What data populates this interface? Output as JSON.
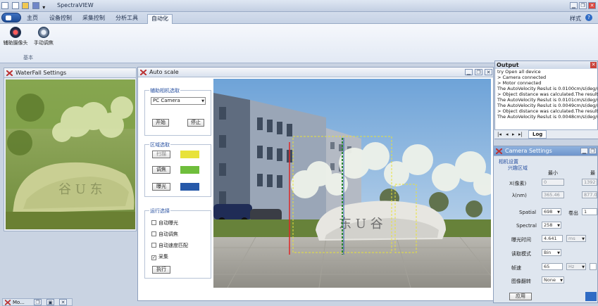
{
  "app": {
    "title": "SpectraVIEW",
    "style_label": "样式",
    "help_icon": "help-icon"
  },
  "tabs": [
    {
      "label": "主页"
    },
    {
      "label": "设备控制"
    },
    {
      "label": "采集控制"
    },
    {
      "label": "分析工具"
    },
    {
      "label": "自动化"
    }
  ],
  "ribbon": {
    "buttons": [
      {
        "label": "辅助摄像头",
        "icon": "camera-icon"
      },
      {
        "label": "手动调焦",
        "icon": "focus-icon"
      }
    ],
    "group_label": "基本"
  },
  "waterfall": {
    "title": "WaterFall Settings"
  },
  "autoscale": {
    "title": "Auto scale",
    "camera_group": {
      "title": "辅助相机选取",
      "select_value": "PC Camera",
      "start_label": "开始",
      "stop_label": "停止"
    },
    "region_group": {
      "title": "区域选取",
      "items": [
        {
          "label": "扫描",
          "color": "#e8e23a"
        },
        {
          "label": "调焦",
          "color": "#6fbe3c"
        },
        {
          "label": "曝光",
          "color": "#2759a9"
        }
      ]
    },
    "run_group": {
      "title": "运行选择",
      "options": [
        {
          "label": "自动曝光",
          "checked": false
        },
        {
          "label": "自动调焦",
          "checked": false
        },
        {
          "label": "自动速度匹配",
          "checked": false
        },
        {
          "label": "采集",
          "checked": true
        }
      ],
      "execute_label": "执行"
    }
  },
  "output": {
    "title": "Output",
    "lines": [
      "try Open all device",
      ">  Camera connected",
      ">  Motor connected",
      "The AutoVelocity Reslut is 0.0100cm/s(deg/s)",
      ">  Object distance was calculated.The result is",
      "The AutoVelocity Reslut is 0.0101cm/s(deg/s)",
      "The AutoVelocity Reslut is 0.0049cm/s(deg/s)",
      ">  Object distance was calculated.The result is",
      "The AutoVelocity Reslut is 0.0048cm/s(deg/s)"
    ],
    "log_tab": "Log"
  },
  "camera_settings": {
    "title": "Camera Settings",
    "section1": "相机设置",
    "section2": "兴趣区域",
    "col_min": "最小",
    "col_max": "最",
    "row_x_label": "X(像素)",
    "row_x_min": "0",
    "row_x_max": "1392",
    "row_l_label": "λ(nm)",
    "row_l_min": "365.46",
    "row_l_max": "877.0",
    "spatial_label": "Spatial",
    "spatial_value": "698",
    "merge_label": "卷出",
    "merge_value": "1",
    "spectral_label": "Spectral",
    "spectral_value": "258",
    "exposure_label": "曝光时间",
    "exposure_value": "4.641",
    "exposure_unit": "ms",
    "readout_label": "读取模式",
    "readout_value": "Bin",
    "frame_label": "帧速",
    "frame_value": "65",
    "frame_unit": "Hz",
    "flip_label": "图像翻转",
    "flip_value": "None",
    "apply_label": "应用"
  },
  "bottom": {
    "label": "Mo..."
  },
  "scene_text": {
    "rock": "东 U 谷",
    "rock_small": "谷 U 东"
  }
}
